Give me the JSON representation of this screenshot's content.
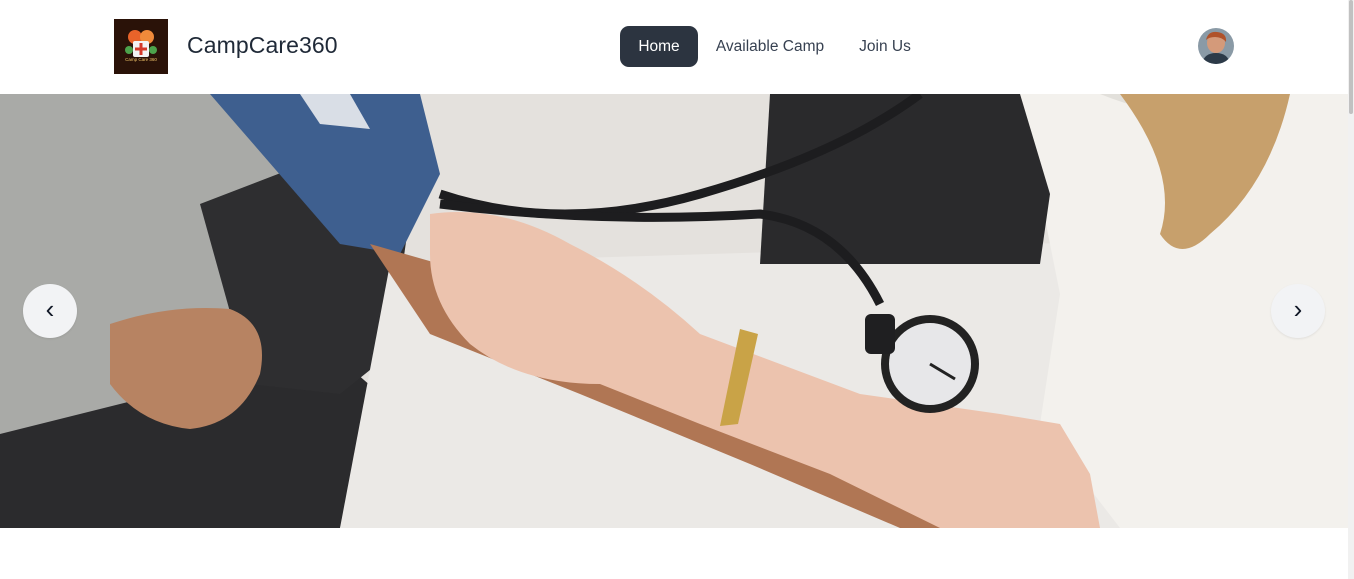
{
  "header": {
    "brand": "CampCare360",
    "logo_text": "Camp Care 360",
    "nav": [
      {
        "label": "Home",
        "active": true
      },
      {
        "label": "Available Camp",
        "active": false
      },
      {
        "label": "Join Us",
        "active": false
      }
    ]
  },
  "hero": {
    "prev_icon": "‹",
    "next_icon": "›"
  },
  "colors": {
    "active_nav_bg": "#2c3440",
    "brand_text": "#1f2937",
    "nav_text": "#374151"
  },
  "icons": [
    "chevron-left-icon",
    "chevron-right-icon"
  ]
}
